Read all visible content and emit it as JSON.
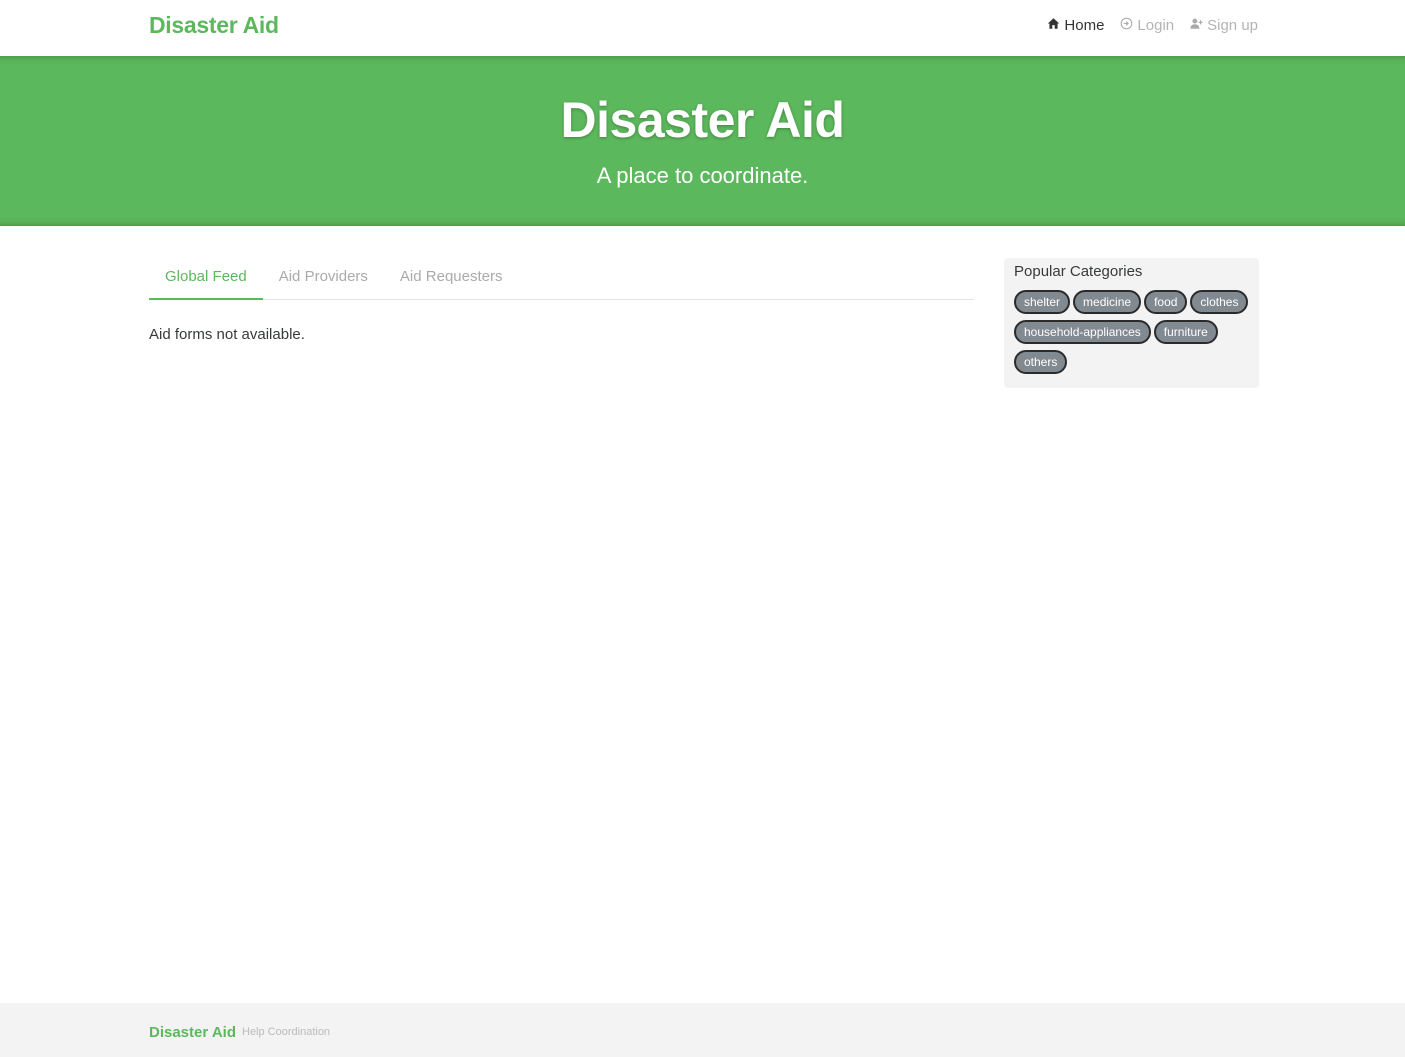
{
  "nav": {
    "brand": "Disaster Aid",
    "links": [
      {
        "label": "Home",
        "icon": "home-icon",
        "active": true
      },
      {
        "label": "Login",
        "icon": "login-icon",
        "active": false
      },
      {
        "label": "Sign up",
        "icon": "add-user-icon",
        "active": false
      }
    ]
  },
  "banner": {
    "title": "Disaster Aid",
    "subtitle": "A place to coordinate."
  },
  "feed": {
    "tabs": [
      {
        "label": "Global Feed",
        "active": true
      },
      {
        "label": "Aid Providers",
        "active": false
      },
      {
        "label": "Aid Requesters",
        "active": false
      }
    ],
    "empty_message": "Aid forms not available."
  },
  "sidebar": {
    "title": "Popular Categories",
    "tags": [
      "shelter",
      "medicine",
      "food",
      "clothes",
      "household-appliances",
      "furniture",
      "others"
    ]
  },
  "footer": {
    "brand": "Disaster Aid",
    "attribution": "Help Coordination"
  },
  "colors": {
    "brand": "#5cb85c",
    "tag_bg": "#818a91",
    "sidebar_bg": "#f3f3f3",
    "footer_bg": "#f3f3f3"
  }
}
